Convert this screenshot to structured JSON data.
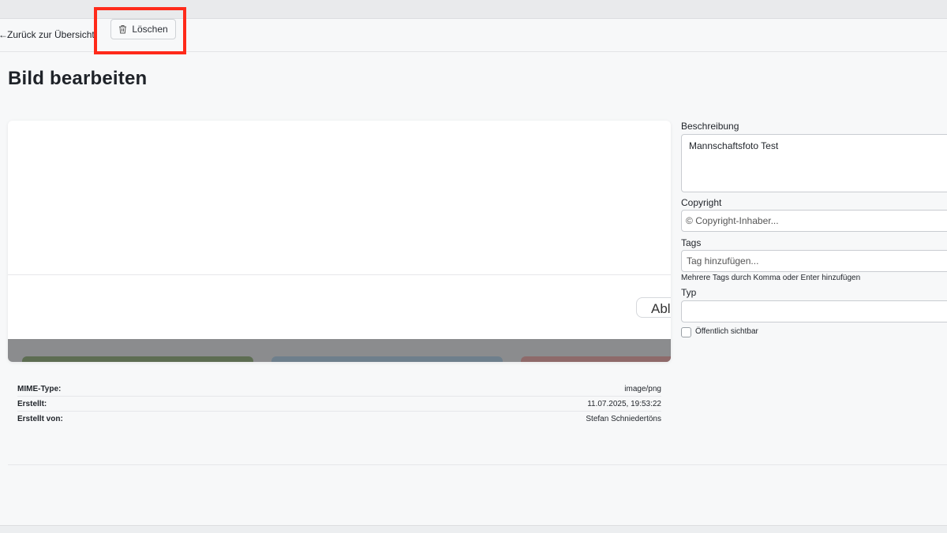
{
  "toolbar": {
    "back_label": "Zurück zur Übersicht",
    "back_arrow": "←",
    "delete_label": "Löschen"
  },
  "page": {
    "title": "Bild bearbeiten"
  },
  "preview": {
    "button_label": "Abl"
  },
  "meta": {
    "rows": [
      {
        "label": "MIME-Type:",
        "value": "image/png"
      },
      {
        "label": "Erstellt:",
        "value": "11.07.2025, 19:53:22"
      },
      {
        "label": "Erstellt von:",
        "value": "Stefan Schniedertöns"
      }
    ]
  },
  "form": {
    "description_label": "Beschreibung",
    "description_value": "Mannschaftsfoto Test",
    "copyright_label": "Copyright",
    "copyright_placeholder": "Copyright-Inhaber...",
    "copyright_symbol": "©",
    "tags_label": "Tags",
    "tags_placeholder": "Tag hinzufügen...",
    "tags_hint": "Mehrere Tags durch Komma oder Enter hinzufügen",
    "type_label": "Typ",
    "type_value": "",
    "public_label": "Öffentlich sichtbar",
    "public_checked": false
  },
  "colors": {
    "highlight": "#ff2a1a",
    "background": "#f7f8f9"
  }
}
